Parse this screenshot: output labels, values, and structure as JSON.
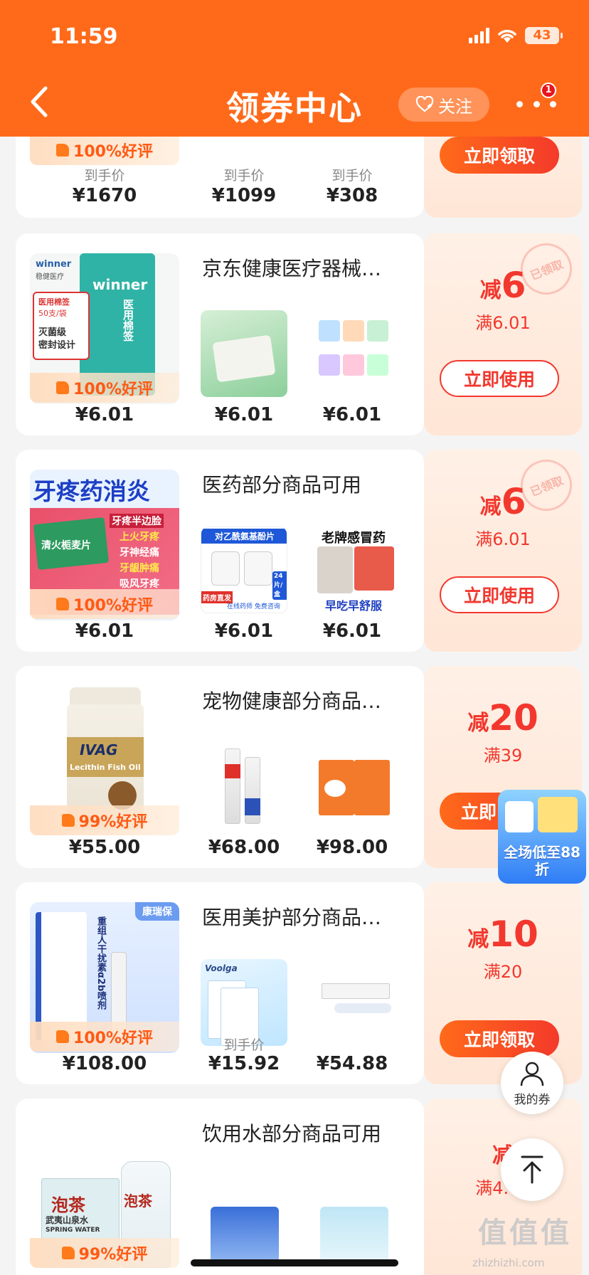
{
  "status_bar": {
    "time": "11:59",
    "battery": "43"
  },
  "header": {
    "title": "领券中心",
    "follow_label": "关注",
    "more_badge": "1"
  },
  "cards": [
    {
      "praise": "100%好评",
      "price_label": "到手价",
      "prices": [
        "¥1670",
        "¥1099",
        "¥308"
      ],
      "coupon_button": "立即领取"
    },
    {
      "title": "京东健康医疗器械…",
      "main_art": {
        "brand": "winner",
        "brand_cn": "稳健医疗",
        "line1": "医用棉签",
        "line2": "50支/袋",
        "line3": "灭菌级",
        "line4": "密封设计"
      },
      "praise": "100%好评",
      "prices": [
        "¥6.01",
        "¥6.01",
        "¥6.01"
      ],
      "coupon_prefix": "减",
      "coupon_amount": "6",
      "coupon_cond": "满6.01",
      "coupon_button": "立即使用",
      "stamp": "已领取"
    },
    {
      "title": "医药部分商品可用",
      "main_art": {
        "headline": "牙疼药消炎",
        "tags": [
          "牙疼半边脸",
          "上火牙疼",
          "牙神经痛",
          "牙龈肿痛",
          "吸风牙疼"
        ],
        "box": "清火栀麦片"
      },
      "art2": {
        "headline": "对乙酰氨基酚片",
        "tag": "药房直发",
        "sub": "在线药师 免费咨询",
        "count": "24片/盒"
      },
      "art3": {
        "headline": "老牌感冒药",
        "sub": "早吃早舒服"
      },
      "praise": "100%好评",
      "prices": [
        "¥6.01",
        "¥6.01",
        "¥6.01"
      ],
      "coupon_prefix": "减",
      "coupon_amount": "6",
      "coupon_cond": "满6.01",
      "coupon_button": "立即使用",
      "stamp": "已领取"
    },
    {
      "title": "宠物健康部分商品…",
      "main_art": {
        "brand": "IVAG",
        "label": "Lecithin Fish Oil"
      },
      "praise": "99%好评",
      "prices": [
        "¥55.00",
        "¥68.00",
        "¥98.00"
      ],
      "coupon_prefix": "减",
      "coupon_amount": "20",
      "coupon_cond": "满39",
      "coupon_button": "立即"
    },
    {
      "title": "医用美护部分商品…",
      "main_art": {
        "brand": "康瑞保",
        "product": "重组人干扰素α2b喷剂"
      },
      "art2": {
        "brand": "Voolga"
      },
      "praise": "100%好评",
      "price_label": "到手价",
      "prices": [
        "¥108.00",
        "¥15.92",
        "¥54.88"
      ],
      "coupon_prefix": "减",
      "coupon_amount": "10",
      "coupon_cond": "满20",
      "coupon_button": "立即领取"
    },
    {
      "title": "饮用水部分商品可用",
      "main_art": {
        "brand": "泡茶",
        "sub": "武夷山泉水",
        "en": "SPRING WATER"
      },
      "praise": "99%好评",
      "coupon_prefix": "减",
      "coupon_amount": "",
      "coupon_cond": "满4.01"
    }
  ],
  "floating": {
    "promo_text": "全场低至88折",
    "my_coupon_label": "我的券"
  },
  "watermark": {
    "text": "值值值",
    "url": "zhizhizhi.com"
  },
  "colors": {
    "brand_orange": "#ff6a1a",
    "coupon_red": "#f2382e"
  }
}
